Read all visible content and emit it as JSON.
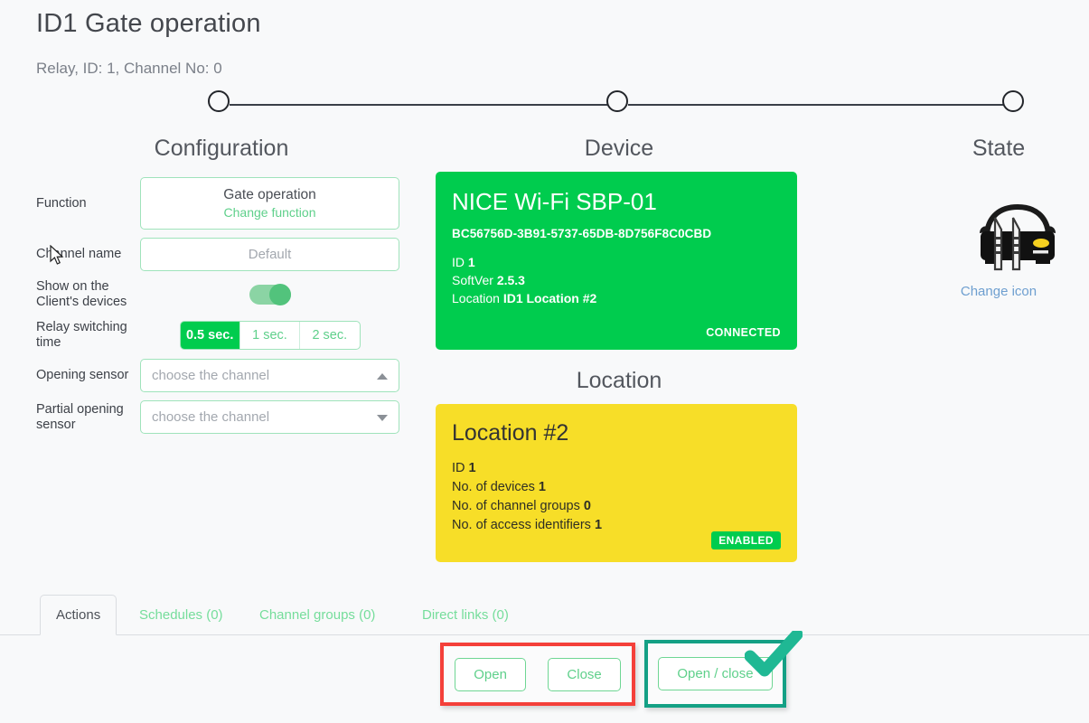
{
  "header": {
    "title": "ID1 Gate operation",
    "subtitle": "Relay, ID: 1, Channel No: 0"
  },
  "stepper": {
    "steps": [
      {
        "label": "Configuration"
      },
      {
        "label": "Device"
      },
      {
        "label": "State"
      }
    ]
  },
  "configuration": {
    "function": {
      "label": "Function",
      "value": "Gate operation",
      "change_link": "Change function"
    },
    "channel_name": {
      "label": "Channel name",
      "value": "",
      "placeholder": "Default"
    },
    "show_on_client": {
      "label": "Show on the Client's devices",
      "state": "on"
    },
    "relay_switching_time": {
      "label": "Relay switching time",
      "options": [
        "0.5 sec.",
        "1 sec.",
        "2 sec."
      ],
      "selected": "0.5 sec."
    },
    "opening_sensor": {
      "label": "Opening sensor",
      "placeholder": "choose the channel",
      "value": "",
      "caret": "caret-up-icon"
    },
    "partial_opening_sensor": {
      "label": "Partial opening sensor",
      "placeholder": "choose the channel",
      "value": "",
      "caret": "caret-down-icon"
    }
  },
  "device": {
    "heading": "Device",
    "name": "NICE Wi-Fi SBP-01",
    "uuid": "BC56756D-3B91-5737-65DB-8D756F8C0CBD",
    "id_label": "ID",
    "id_value": "1",
    "softver_label": "SoftVer",
    "softver_value": "2.5.3",
    "location_label": "Location",
    "location_value": "ID1 Location #2",
    "status": "CONNECTED",
    "color": "#00cc4e"
  },
  "location": {
    "heading": "Location",
    "name": "Location #2",
    "id_label": "ID",
    "id_value": "1",
    "devices_label": "No. of devices",
    "devices_value": "1",
    "channel_groups_label": "No. of channel groups",
    "channel_groups_value": "0",
    "access_identifiers_label": "No. of access identifiers",
    "access_identifiers_value": "1",
    "status": "ENABLED",
    "color": "#f7de28"
  },
  "state": {
    "heading": "State",
    "icon": "car-gate-icon",
    "change_icon_link": "Change icon"
  },
  "tabs": [
    {
      "label": "Actions",
      "active": true
    },
    {
      "label": "Schedules (0)",
      "active": false
    },
    {
      "label": "Channel groups (0)",
      "active": false
    },
    {
      "label": "Direct links (0)",
      "active": false
    }
  ],
  "actions": {
    "open_label": "Open",
    "close_label": "Close",
    "open_close_label": "Open / close"
  },
  "annotations": {
    "red_box_color": "#f4403a",
    "teal_box_color": "#14a085",
    "check_icon": "check-icon"
  }
}
